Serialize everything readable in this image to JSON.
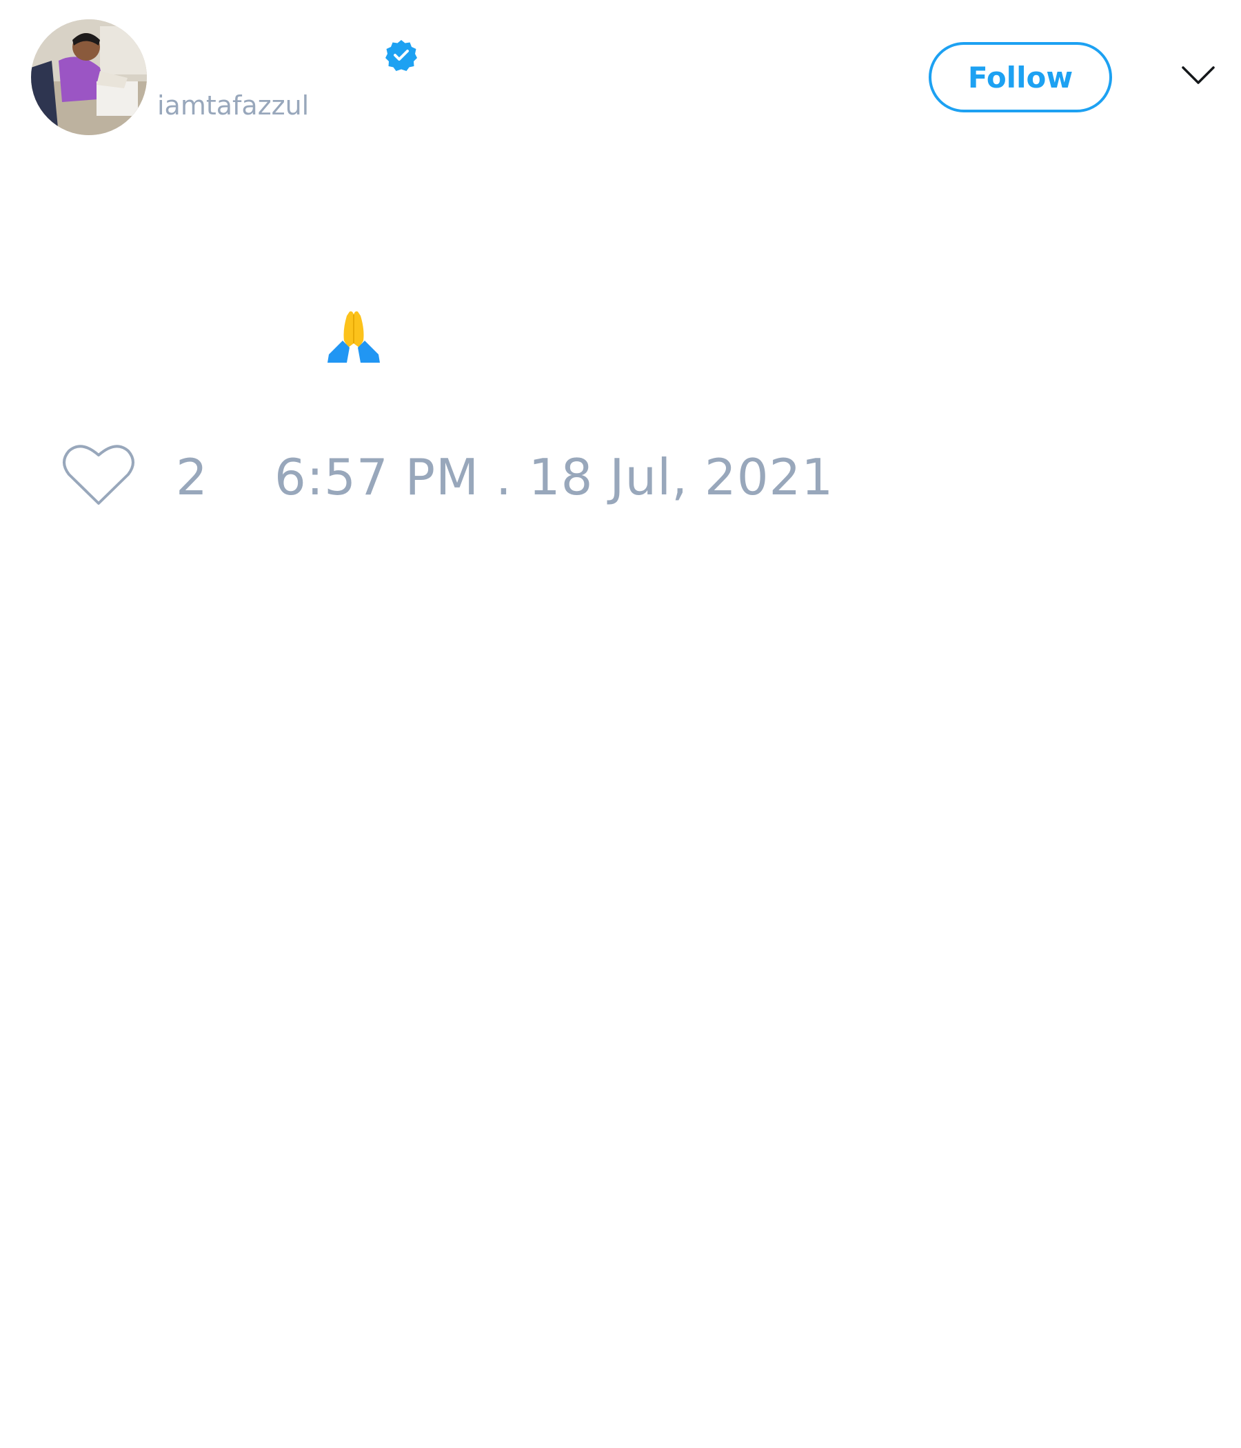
{
  "author": {
    "display_name": "",
    "handle": "iamtafazzul",
    "verified": true,
    "avatar_icon": "user-photo-avatar"
  },
  "header": {
    "follow_label": "Follow",
    "menu_icon": "chevron-down-icon"
  },
  "tweet": {
    "text_icon": "folded-hands-emoji",
    "like_count": "2",
    "timestamp": "6:57 PM . 18 Jul, 2021"
  },
  "colors": {
    "accent": "#1da1f2",
    "muted_text": "#98a7bb",
    "icon_stroke": "#98a7bb"
  }
}
